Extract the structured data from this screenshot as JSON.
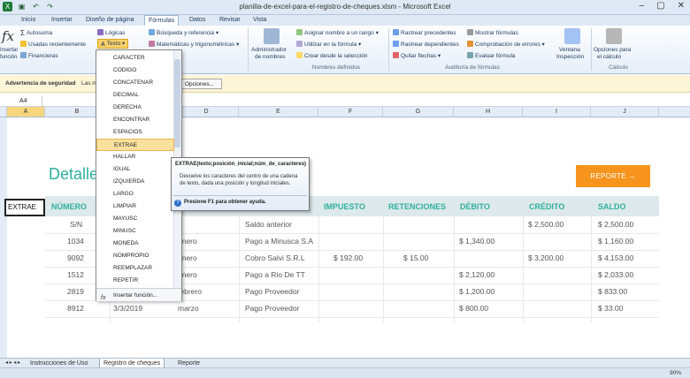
{
  "window": {
    "title": "planilla-de-excel-para-el-registro-de-cheques.xlsm - Microsoft Excel",
    "controls": [
      "–",
      "▢",
      "✕"
    ]
  },
  "tabs": [
    "Inicio",
    "Insertar",
    "Diseño de página",
    "Fórmulas",
    "Datos",
    "Revisar",
    "Vista"
  ],
  "active_tab": "Fórmulas",
  "ribbon": {
    "insert_function": [
      "Insertar",
      "función"
    ],
    "autosuma": "Autosuma",
    "recientes": "Usadas recientemente",
    "financieras": "Financieras",
    "logicas": "Lógicas",
    "texto": "Texto",
    "busqueda": "Búsqueda y referencia",
    "matematicas": "Matemáticas y trigonométricas",
    "administrador": [
      "Administrador",
      "de nombres"
    ],
    "asignar": "Asignar nombre a un rango",
    "utilizar": "Utilizar en la fórmula",
    "crear": "Crear desde la selección",
    "nombres_label": "Nombres definidos",
    "rastrear_prec": "Rastrear precedentes",
    "rastrear_dep": "Rastrear dependientes",
    "quitar": "Quitar flechas",
    "mostrar": "Mostrar fórmulas",
    "comprobacion": "Comprobación de errores",
    "evaluar": "Evaluar fórmula",
    "auditoria_label": "Auditoría de fórmulas",
    "ventana": [
      "Ventana",
      "Inspección"
    ],
    "opciones": [
      "Opciones para",
      "el cálculo"
    ],
    "calculo_label": "Cálculo"
  },
  "security": {
    "label": "Advertencia de seguridad",
    "message": "Las m",
    "button": "Opciones..."
  },
  "namebox": "A4",
  "columns": [
    "A",
    "B",
    "C",
    "D",
    "E",
    "F",
    "G",
    "H",
    "I",
    "J"
  ],
  "sheet": {
    "title": "Detalle",
    "selected_cell_value": "EXTRAE",
    "report_button": "REPORTE →",
    "headers": [
      "NÚMERO",
      "IMPUESTO",
      "RETENCIONES",
      "DÉBITO",
      "CRÉDITO",
      "SALDO"
    ],
    "rows": [
      {
        "numero": "S/N",
        "fecha": "",
        "mes": "",
        "desc": "Saldo anterior",
        "impuesto": "",
        "retenciones": "",
        "debito": "",
        "credito": "$ 2,500.00",
        "saldo": "$ 2,500.00"
      },
      {
        "numero": "1034",
        "fecha": "",
        "mes": "enero",
        "desc": "Pago a Minusca S.A",
        "impuesto": "",
        "retenciones": "",
        "debito": "$ 1,340.00",
        "credito": "",
        "saldo": "$ 1,160.00"
      },
      {
        "numero": "9092",
        "fecha": "",
        "mes": "enero",
        "desc": "Cobro Salvi S.R.L",
        "impuesto": "$ 192.00",
        "retenciones": "$ 15.00",
        "debito": "",
        "credito": "$ 3,200.00",
        "saldo": "$ 4,153.00"
      },
      {
        "numero": "1512",
        "fecha": "",
        "mes": "enero",
        "desc": "Pago a Rio De TT",
        "impuesto": "",
        "retenciones": "",
        "debito": "$ 2,120.00",
        "credito": "",
        "saldo": "$ 2,033.00"
      },
      {
        "numero": "2819",
        "fecha": "",
        "mes": "febrero",
        "desc": "Pago Proveedor",
        "impuesto": "",
        "retenciones": "",
        "debito": "$ 1,200.00",
        "credito": "",
        "saldo": "$ 833.00"
      },
      {
        "numero": "8912",
        "fecha": "3/3/2019",
        "mes": "marzo",
        "desc": "Pago Proveedor",
        "impuesto": "",
        "retenciones": "",
        "debito": "$ 800.00",
        "credito": "",
        "saldo": "$ 33.00"
      }
    ]
  },
  "dropdown": {
    "items": [
      "CARACTER",
      "CODIGO",
      "CONCATENAR",
      "DECIMAL",
      "DERECHA",
      "ENCONTRAR",
      "ESPACIOS",
      "EXTRAE",
      "HALLAR",
      "IGUAL",
      "IZQUIERDA",
      "LARGO",
      "LIMPIAR",
      "MAYUSC",
      "MINUSC",
      "MONEDA",
      "NOMPROPIO",
      "REEMPLAZAR",
      "REPETIR"
    ],
    "highlighted": "EXTRAE",
    "footer": "Insertar función..."
  },
  "tooltip": {
    "signature": "EXTRAE(texto;posición_inicial;núm_de_caracteres)",
    "description": "Devuelve los caracteres del centro de una cadena de texto, dada una posición y longitud iniciales.",
    "help": "Presione F1 para obtener ayuda."
  },
  "sheet_tabs": [
    "Instrucciones de Uso",
    "Registro de cheques",
    "Reporte"
  ],
  "active_sheet": "Registro de cheques",
  "zoom": "90%"
}
